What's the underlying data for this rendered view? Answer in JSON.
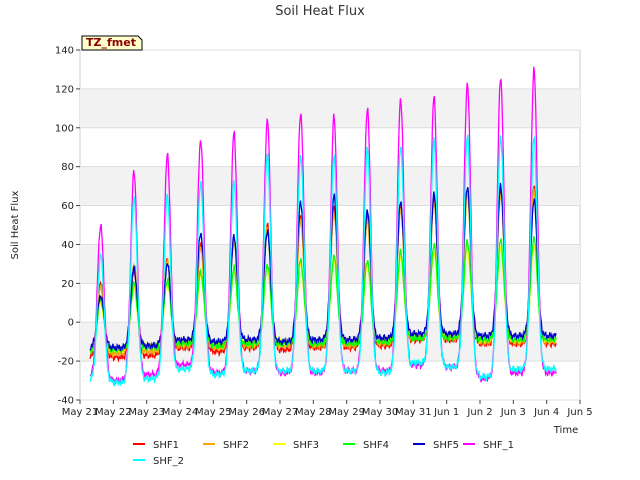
{
  "chart_data": {
    "type": "line",
    "title": "Soil Heat Flux",
    "xlabel": "Time",
    "ylabel": "Soil Heat Flux",
    "badge": "TZ_fmet",
    "ylim": [
      -40,
      140
    ],
    "yticks": [
      -40,
      -20,
      0,
      20,
      40,
      60,
      80,
      100,
      120,
      140
    ],
    "xticks": [
      "May 21",
      "May 22",
      "May 23",
      "May 24",
      "May 25",
      "May 26",
      "May 27",
      "May 28",
      "May 29",
      "May 30",
      "May 31",
      "Jun 1",
      "Jun 2",
      "Jun 3",
      "Jun 4",
      "Jun 5"
    ],
    "xlim_days": [
      0,
      15
    ],
    "data_range_days": [
      0.3,
      14.3
    ],
    "grid": "horizontal-bands",
    "legend_position": "bottom",
    "series": [
      {
        "name": "SHF1",
        "color": "#ff0000",
        "peaks": [
          20,
          27,
          32,
          40,
          44,
          50,
          55,
          60,
          55,
          60,
          64,
          68,
          68,
          70
        ],
        "troughs": [
          -18,
          -18,
          -17,
          -13,
          -15,
          -13,
          -14,
          -13,
          -13,
          -12,
          -9,
          -9,
          -11,
          -11
        ]
      },
      {
        "name": "SHF2",
        "color": "#ffa500",
        "peaks": [
          18,
          30,
          32,
          38,
          42,
          48,
          52,
          56,
          52,
          58,
          62,
          66,
          66,
          68
        ],
        "troughs": [
          -16,
          -16,
          -15,
          -12,
          -13,
          -12,
          -12,
          -12,
          -12,
          -11,
          -8,
          -8,
          -10,
          -10
        ]
      },
      {
        "name": "SHF3",
        "color": "#ffff00",
        "peaks": [
          10,
          18,
          20,
          24,
          26,
          28,
          30,
          32,
          30,
          33,
          36,
          38,
          38,
          40
        ],
        "troughs": [
          -14,
          -14,
          -12,
          -10,
          -11,
          -10,
          -10,
          -10,
          -10,
          -9,
          -7,
          -7,
          -9,
          -9
        ]
      },
      {
        "name": "SHF4",
        "color": "#00ff00",
        "peaks": [
          12,
          20,
          22,
          26,
          28,
          30,
          32,
          34,
          32,
          36,
          40,
          42,
          42,
          44
        ],
        "troughs": [
          -15,
          -14,
          -13,
          -11,
          -12,
          -11,
          -11,
          -11,
          -11,
          -10,
          -8,
          -8,
          -9,
          -9
        ]
      },
      {
        "name": "SHF5",
        "color": "#0000cd",
        "peaks": [
          14,
          28,
          30,
          46,
          44,
          47,
          62,
          65,
          58,
          62,
          66,
          70,
          70,
          63
        ],
        "troughs": [
          -13,
          -13,
          -12,
          -9,
          -10,
          -9,
          -10,
          -9,
          -9,
          -8,
          -6,
          -6,
          -7,
          -7
        ]
      },
      {
        "name": "SHF_1",
        "color": "#ff00ff",
        "peaks": [
          50,
          78,
          86,
          94,
          98,
          104,
          108,
          106,
          110,
          115,
          116,
          123,
          126,
          130
        ],
        "troughs": [
          -28,
          -30,
          -27,
          -22,
          -26,
          -25,
          -26,
          -26,
          -25,
          -25,
          -22,
          -23,
          -29,
          -26
        ]
      },
      {
        "name": "SHF_2",
        "color": "#00ffff",
        "peaks": [
          35,
          65,
          65,
          72,
          73,
          86,
          86,
          86,
          89,
          91,
          94,
          96,
          96,
          95
        ],
        "troughs": [
          -30,
          -31,
          -29,
          -24,
          -27,
          -25,
          -25,
          -25,
          -25,
          -26,
          -21,
          -23,
          -28,
          -24
        ]
      }
    ]
  }
}
